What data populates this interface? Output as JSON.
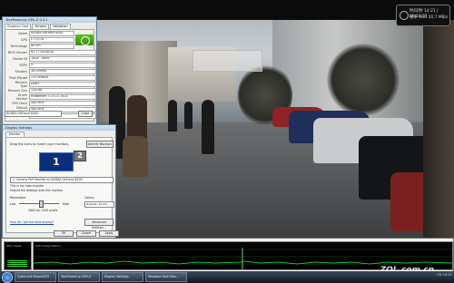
{
  "clock_gadget": {
    "line1": "时间/秒 14:21 | 00:14:21",
    "line2": "帧率 VCC 20.7 MB/s"
  },
  "gpuz": {
    "title": "TechPowerUp GPU-Z 0.3.2",
    "tabs": [
      "Graphics Card",
      "Sensors",
      "Validation"
    ],
    "rows": [
      {
        "label": "Name",
        "value": "NVIDIA GeForce 8200"
      },
      {
        "label": "GPU",
        "value": "C77/C78"
      },
      {
        "label": "Technology",
        "value": "80 nm"
      },
      {
        "label": "BIOS Version",
        "value": "62.77.4A.00.00"
      },
      {
        "label": "Device ID",
        "value": "10DE - 0849"
      },
      {
        "label": "ROPs",
        "value": "4"
      },
      {
        "label": "Shaders",
        "value": "16 Unified"
      },
      {
        "label": "Pixel Fillrate",
        "value": "2.0 GPixel/s"
      },
      {
        "label": "Memory Type",
        "value": "DDR2"
      },
      {
        "label": "Memory Size",
        "value": "128 MB"
      },
      {
        "label": "Driver Version",
        "value": "nvlddmkm 7.15.11.7824"
      },
      {
        "label": "GPU Clock",
        "value": "500 MHz"
      },
      {
        "label": "Default Clock",
        "value": "500 MHz"
      },
      {
        "label": "NVIDIA SLI",
        "value": "Disabled"
      }
    ],
    "selected_card": "NVIDIA GeForce 8200",
    "close_label": "Close"
  },
  "display_settings": {
    "title": "Display Settings",
    "tab": "Monitor",
    "hint": "Drag the icons to match your monitors.",
    "identify_label": "Identify Monitors",
    "monitor1": "1",
    "monitor2": "2",
    "monitor_select": "1. Generic PnP Monitor on NVIDIA GeForce 8200",
    "check1": "This is my main monitor",
    "check2": "Extend the desktop onto this monitor",
    "resolution_label": "Resolution:",
    "low": "Low",
    "high": "High",
    "resolution_value": "1600 by 1200 pixels",
    "colors_label": "Colors:",
    "colors_value": "Highest (32 bit)",
    "help_link": "How do I get the best display?",
    "advanced_label": "Advanced Settings...",
    "buttons": [
      "OK",
      "Cancel",
      "Apply"
    ]
  },
  "gpu_monitor": {
    "caption1": "GPU Usage",
    "caption2": "GPU Usage History"
  },
  "taskbar": {
    "items": [
      "CyberLink PowerDVD",
      "TechPowerUp GPU-Z",
      "Display Settings",
      "Windows Task Man..."
    ],
    "tray": "CH 14:21"
  },
  "watermark": "ZOL.com.cn"
}
